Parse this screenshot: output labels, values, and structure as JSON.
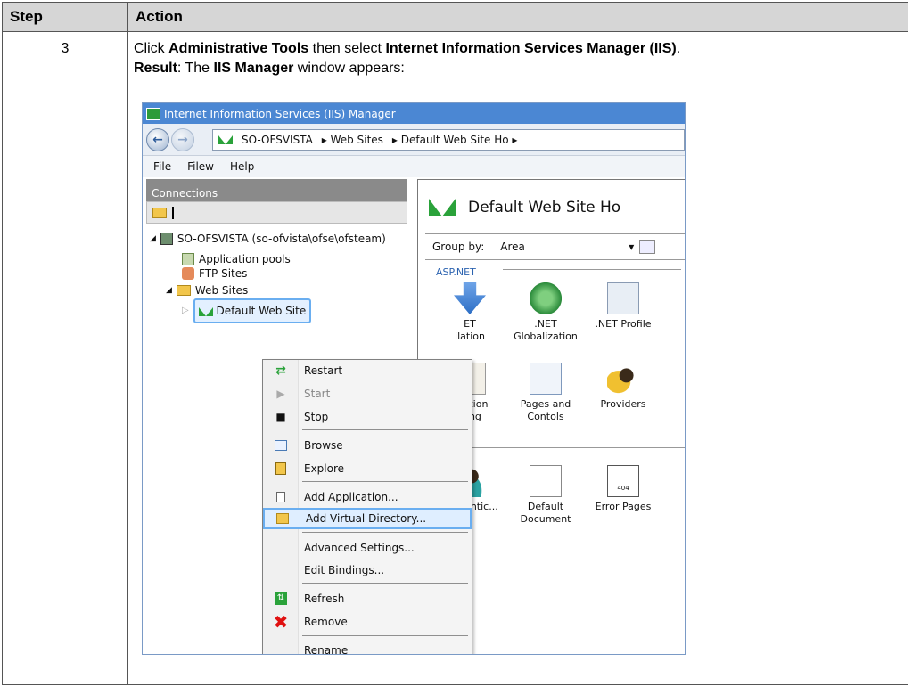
{
  "table": {
    "header_step": "Step",
    "header_action": "Action",
    "step_number": "3",
    "line1_a": "Click ",
    "line1_b": "Administrative Tools",
    "line1_c": " then select ",
    "line1_d": "Internet Information Services Manager (IIS)",
    "line1_e": ".",
    "line2_a": "Result",
    "line2_b": ": The ",
    "line2_c": "IIS Manager",
    "line2_d": " window appears:"
  },
  "window": {
    "title": "Internet Information Services (IIS) Manager",
    "address": [
      "SO-OFSVISTA",
      "▸  Web Sites",
      "▸  Default Web Site Ho  ▸"
    ],
    "menu": [
      "File",
      "Filew",
      "Help"
    ]
  },
  "connections": {
    "header": "Connections",
    "tree": {
      "server": "SO-OFSVISTA  (so-ofvista\\ofse\\ofsteam)",
      "app_pools": "Application pools",
      "ftp_sites": "FTP Sites",
      "web_sites": "Web Sites",
      "default_site": "Default Web Site"
    }
  },
  "features": {
    "title": "Default Web Site Ho",
    "group_by_label": "Group by:",
    "group_by_value": "Area",
    "section": "ASP.NET",
    "items": {
      "net_comp_1": "ET",
      "net_comp_2": "ilation",
      "net_glob_1": ".NET",
      "net_glob_2": "Globalization",
      "net_profile": ".NET Profile",
      "conn_1": "nection",
      "conn_2": "tring",
      "pages_1": "Pages and",
      "pages_2": "Contols",
      "providers": "Providers",
      "auth": "Authentic...",
      "default_doc_1": "Default",
      "default_doc_2": "Document",
      "error_pages": "Error Pages",
      "error_icon_text": "404"
    }
  },
  "context_menu": {
    "restart": "Restart",
    "start": "Start",
    "stop": "Stop",
    "browse": "Browse",
    "explore": "Explore",
    "add_app": "Add Application...",
    "add_vdir": "Add Virtual Directory...",
    "adv_settings": "Advanced Settings...",
    "edit_bindings": "Edit Bindings...",
    "refresh": "Refresh",
    "remove": "Remove",
    "rename": "Rename"
  }
}
